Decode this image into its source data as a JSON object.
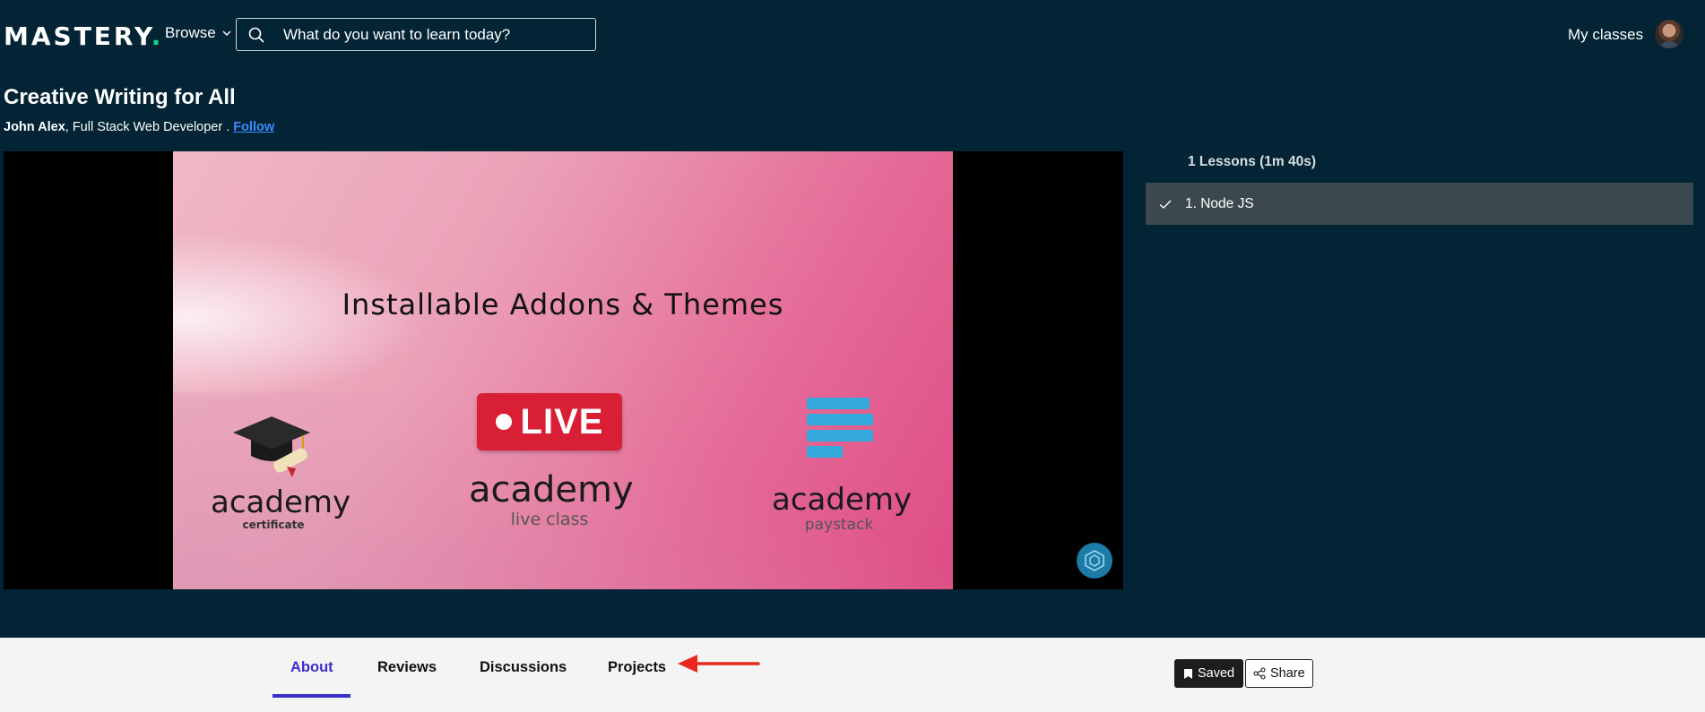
{
  "header": {
    "logo_text": "MASTERY",
    "logo_dot": ".",
    "browse_label": "Browse",
    "search_placeholder": "What do you want to learn today?",
    "my_classes_label": "My classes"
  },
  "course": {
    "title": "Creative Writing for All",
    "instructor_name": "John Alex",
    "instructor_role": ", Full Stack Web Developer . ",
    "follow_label": "Follow"
  },
  "video": {
    "slide_title": "Installable Addons & Themes",
    "addons": [
      {
        "name": "academy",
        "sub": "certificate"
      },
      {
        "name": "academy",
        "sub": "live class",
        "badge": "LIVE"
      },
      {
        "name": "academy",
        "sub": "paystack"
      }
    ]
  },
  "lessons": {
    "heading": "1 Lessons (1m 40s)",
    "items": [
      {
        "label": "1. Node JS",
        "completed": true
      }
    ]
  },
  "tabs": [
    {
      "label": "About",
      "active": true
    },
    {
      "label": "Reviews",
      "active": false
    },
    {
      "label": "Discussions",
      "active": false
    },
    {
      "label": "Projects",
      "active": false
    }
  ],
  "actions": {
    "saved_label": "Saved",
    "share_label": "Share"
  },
  "colors": {
    "background": "#022435",
    "accent": "#3a2fc9",
    "logo_dot": "#19d38a",
    "link": "#3d8bff",
    "arrow": "#e8281c"
  }
}
